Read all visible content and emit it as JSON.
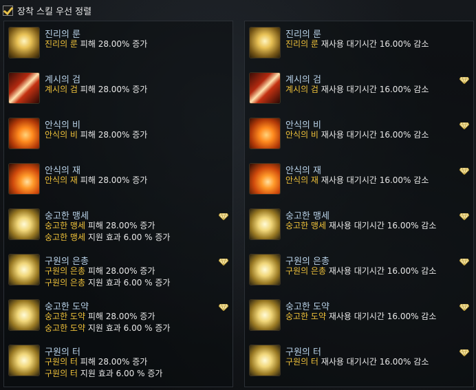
{
  "header": {
    "sort_label": "장착 스킬 우선 정렬",
    "checked": true
  },
  "left": [
    {
      "name": "진리의 룬",
      "icon": "golden-rune-icon",
      "gem": false,
      "lines": [
        {
          "hl": "진리의 룬",
          "text": " 피해 28.00% 증가"
        }
      ]
    },
    {
      "name": "계시의 검",
      "icon": "crossed-swords-icon",
      "gem": false,
      "lines": [
        {
          "hl": "계시의 검",
          "text": " 피해 28.00% 증가"
        }
      ]
    },
    {
      "name": "안식의 비",
      "icon": "fire-rain-icon",
      "gem": false,
      "lines": [
        {
          "hl": "안식의 비",
          "text": " 피해 28.00% 증가"
        }
      ]
    },
    {
      "name": "안식의 재",
      "icon": "ember-burst-icon",
      "gem": false,
      "lines": [
        {
          "hl": "안식의 재",
          "text": " 피해 28.00% 증가"
        }
      ]
    },
    {
      "name": "숭고한 맹세",
      "icon": "holy-oath-icon",
      "gem": true,
      "lines": [
        {
          "hl": "숭고한 맹세",
          "text": " 피해 28.00% 증가"
        },
        {
          "hl": "숭고한 맹세",
          "text": " 지원 효과 6.00 % 증가"
        }
      ]
    },
    {
      "name": "구원의 은총",
      "icon": "holy-grace-icon",
      "gem": true,
      "lines": [
        {
          "hl": "구원의 은총",
          "text": " 피해 28.00% 증가"
        },
        {
          "hl": "구원의 은총",
          "text": " 지원 효과 6.00 % 증가"
        }
      ]
    },
    {
      "name": "숭고한 도약",
      "icon": "holy-leap-icon",
      "gem": true,
      "lines": [
        {
          "hl": "숭고한 도약",
          "text": " 피해 28.00% 증가"
        },
        {
          "hl": "숭고한 도약",
          "text": " 지원 효과 6.00 % 증가"
        }
      ]
    },
    {
      "name": "구원의 터",
      "icon": "holy-ground-icon",
      "gem": false,
      "lines": [
        {
          "hl": "구원의 터",
          "text": " 피해 28.00% 증가"
        },
        {
          "hl": "구원의 터",
          "text": " 지원 효과 6.00 % 증가"
        }
      ]
    }
  ],
  "right": [
    {
      "name": "진리의 룬",
      "icon": "golden-rune-icon",
      "gem": false,
      "lines": [
        {
          "hl": "진리의 룬",
          "text": " 재사용 대기시간 16.00% 감소"
        }
      ]
    },
    {
      "name": "계시의 검",
      "icon": "crossed-swords-icon",
      "gem": true,
      "lines": [
        {
          "hl": "계시의 검",
          "text": " 재사용 대기시간 16.00% 감소"
        }
      ]
    },
    {
      "name": "안식의 비",
      "icon": "fire-rain-icon",
      "gem": true,
      "lines": [
        {
          "hl": "안식의 비",
          "text": " 재사용 대기시간 16.00% 감소"
        }
      ]
    },
    {
      "name": "안식의 재",
      "icon": "ember-burst-icon",
      "gem": true,
      "lines": [
        {
          "hl": "안식의 재",
          "text": " 재사용 대기시간 16.00% 감소"
        }
      ]
    },
    {
      "name": "숭고한 맹세",
      "icon": "holy-oath-icon",
      "gem": true,
      "lines": [
        {
          "hl": "숭고한 맹세",
          "text": " 재사용 대기시간 16.00% 감소"
        }
      ]
    },
    {
      "name": "구원의 은총",
      "icon": "holy-grace-icon",
      "gem": true,
      "lines": [
        {
          "hl": "구원의 은총",
          "text": " 재사용 대기시간 16.00% 감소"
        }
      ]
    },
    {
      "name": "숭고한 도약",
      "icon": "holy-leap-icon",
      "gem": true,
      "lines": [
        {
          "hl": "숭고한 도약",
          "text": " 재사용 대기시간 16.00% 감소"
        }
      ]
    },
    {
      "name": "구원의 터",
      "icon": "holy-ground-icon",
      "gem": true,
      "lines": [
        {
          "hl": "구원의 터",
          "text": " 재사용 대기시간 16.00% 감소"
        }
      ]
    }
  ]
}
